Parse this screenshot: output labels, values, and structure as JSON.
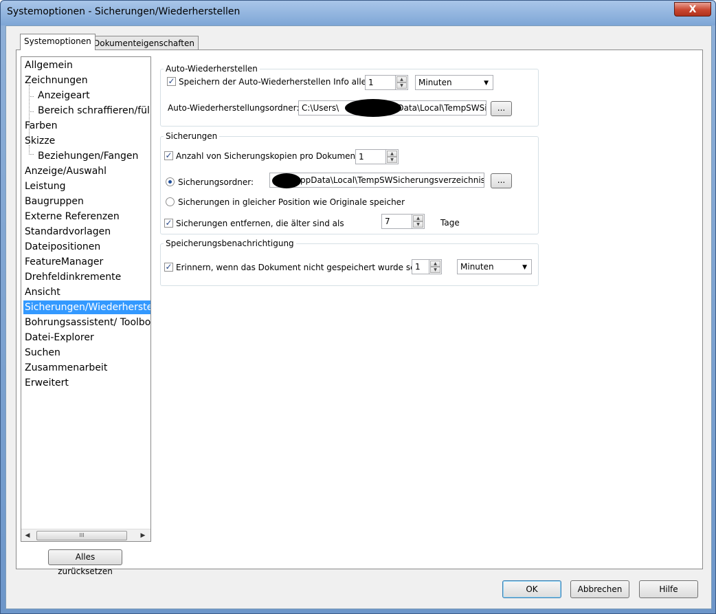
{
  "window": {
    "title": "Systemoptionen - Sicherungen/Wiederherstellen",
    "close_glyph": "X"
  },
  "tabs": [
    "Systemoptionen",
    "Dokumenteigenschaften"
  ],
  "tree": {
    "items": [
      {
        "label": "Allgemein",
        "level": 0
      },
      {
        "label": "Zeichnungen",
        "level": 0
      },
      {
        "label": "Anzeigeart",
        "level": 1
      },
      {
        "label": "Bereich schraffieren/fülle",
        "level": 1
      },
      {
        "label": "Farben",
        "level": 0
      },
      {
        "label": "Skizze",
        "level": 0
      },
      {
        "label": "Beziehungen/Fangen",
        "level": 1
      },
      {
        "label": "Anzeige/Auswahl",
        "level": 0
      },
      {
        "label": "Leistung",
        "level": 0
      },
      {
        "label": "Baugruppen",
        "level": 0
      },
      {
        "label": "Externe Referenzen",
        "level": 0
      },
      {
        "label": "Standardvorlagen",
        "level": 0
      },
      {
        "label": "Dateipositionen",
        "level": 0
      },
      {
        "label": "FeatureManager",
        "level": 0
      },
      {
        "label": "Drehfeldinkremente",
        "level": 0
      },
      {
        "label": "Ansicht",
        "level": 0
      },
      {
        "label": "Sicherungen/Wiederherstell",
        "level": 0,
        "selected": true
      },
      {
        "label": "Bohrungsassistent/ Toolbox",
        "level": 0
      },
      {
        "label": "Datei-Explorer",
        "level": 0
      },
      {
        "label": "Suchen",
        "level": 0
      },
      {
        "label": "Zusammenarbeit",
        "level": 0
      },
      {
        "label": "Erweitert",
        "level": 0
      }
    ],
    "scroll_left": "◀",
    "scroll_right": "▶",
    "scroll_thumb_grip": "III"
  },
  "reset_button": "Alles zurücksetzen",
  "auto_restore": {
    "title": "Auto-Wiederherstellen",
    "save_label": "Speichern der Auto-Wiederherstellen Info alle:",
    "save_checked": true,
    "save_value": "1",
    "save_unit": "Minuten",
    "folder_label": "Auto-Wiederherstellungsordner:",
    "folder_value_start": "C:\\Users\\",
    "folder_value_end": "ppData\\Local\\TempSWSi",
    "browse": "..."
  },
  "backups": {
    "title": "Sicherungen",
    "count_label": "Anzahl von Sicherungskopien pro Dokument",
    "count_checked": true,
    "count_value": "1",
    "folder_radio_label": "Sicherungsordner:",
    "folder_selected": true,
    "folder_value": "ppData\\Local\\TempSWSicherungsverzeichnis",
    "browse": "...",
    "same_position_label": "Sicherungen in gleicher Position wie Originale speicher",
    "remove_label": "Sicherungen entfernen, die älter sind als",
    "remove_checked": true,
    "remove_value": "7",
    "remove_unit": "Tage"
  },
  "notification": {
    "title": "Speicherungsbenachrichtigung",
    "remind_label": "Erinnern, wenn das Dokument nicht gespeichert wurde seit",
    "remind_checked": true,
    "remind_value": "1",
    "remind_unit": "Minuten"
  },
  "footer": {
    "ok": "OK",
    "cancel": "Abbrechen",
    "help": "Hilfe"
  },
  "glyphs": {
    "check": "✓",
    "spin_up": "▲",
    "spin_down": "▼",
    "caret": "▼"
  }
}
